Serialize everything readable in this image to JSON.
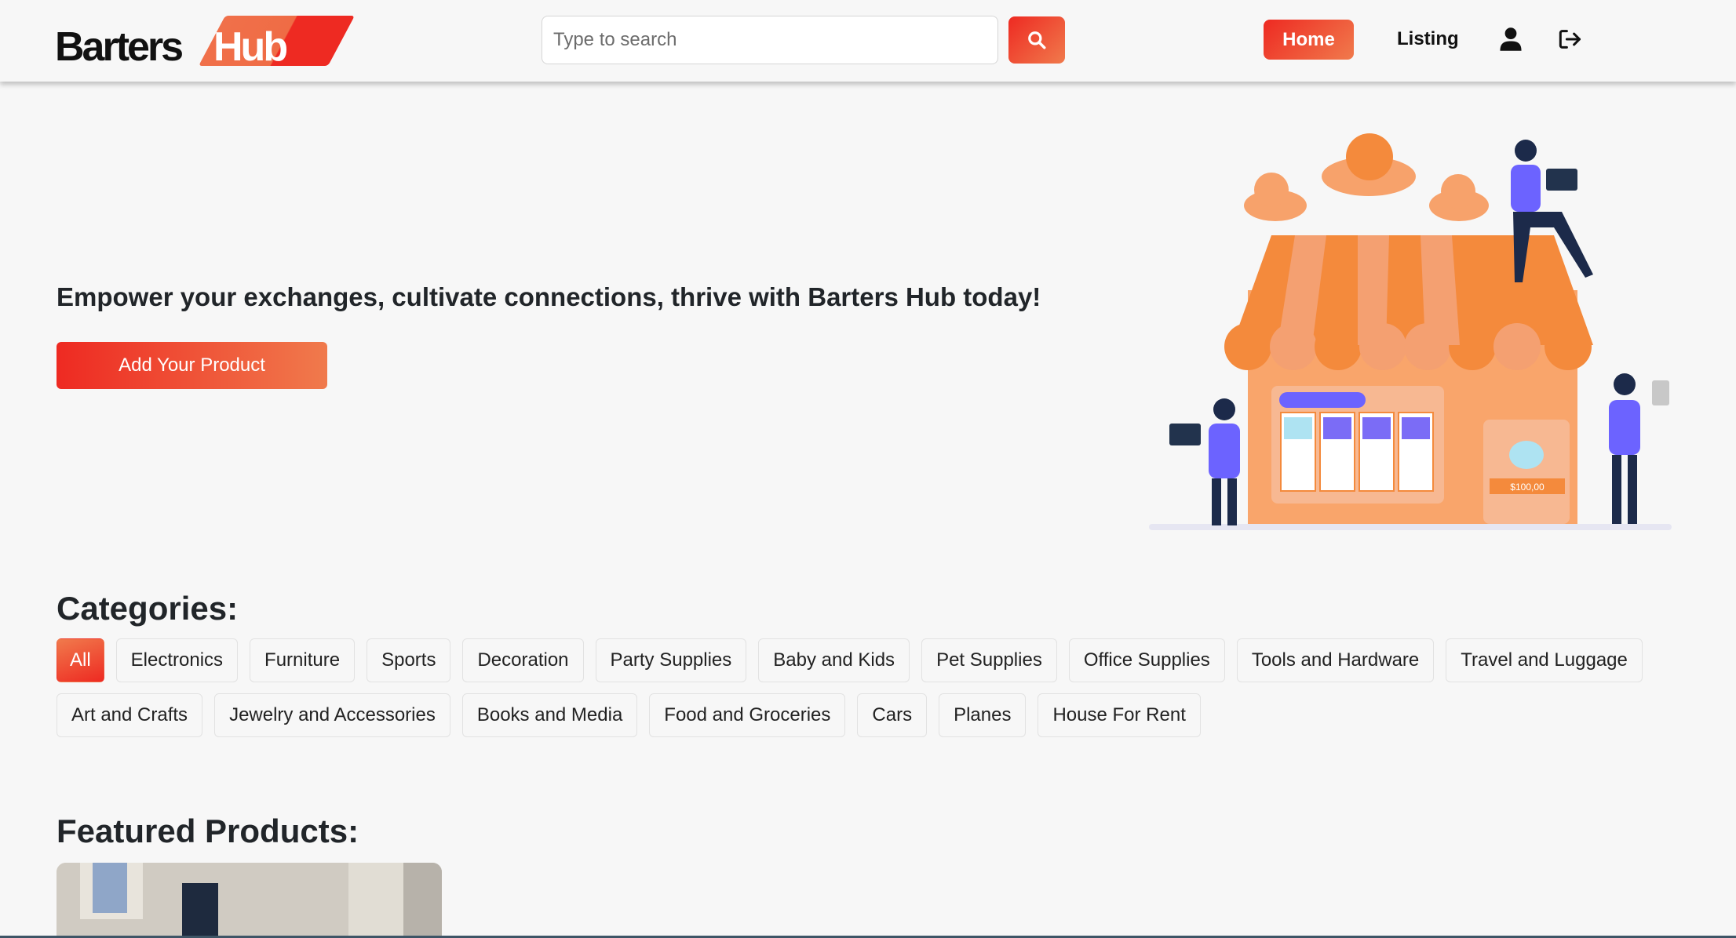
{
  "header": {
    "logo": {
      "primary": "Barters",
      "accent": "Hub"
    },
    "search": {
      "placeholder": "Type to search",
      "value": "",
      "icon": "search-icon"
    },
    "nav": {
      "home_label": "Home",
      "listing_label": "Listing",
      "profile_icon": "user-icon",
      "logout_icon": "logout-icon"
    }
  },
  "hero": {
    "tagline": "Empower your exchanges, cultivate connections, thrive with Barters Hub today!",
    "cta_label": "Add Your Product",
    "illustration": {
      "description": "Online storefront illustration with awning, clouds and people using laptops and tablets",
      "price_tag": "$100,00"
    }
  },
  "categories": {
    "title": "Categories:",
    "active": "All",
    "items": [
      "All",
      "Electronics",
      "Furniture",
      "Sports",
      "Decoration",
      "Party Supplies",
      "Baby and Kids",
      "Pet Supplies",
      "Office Supplies",
      "Tools and Hardware",
      "Travel and Luggage",
      "Art and Crafts",
      "Jewelry and Accessories",
      "Books and Media",
      "Food and Groceries",
      "Cars",
      "Planes",
      "House For Rent"
    ]
  },
  "featured": {
    "title": "Featured Products:",
    "products": [
      {
        "image": "Empty room interior with window and doorway"
      }
    ]
  },
  "colors": {
    "brand_red": "#ee2a22",
    "brand_orange": "#f07a4c",
    "background": "#f7f7f7",
    "text": "#212529"
  }
}
